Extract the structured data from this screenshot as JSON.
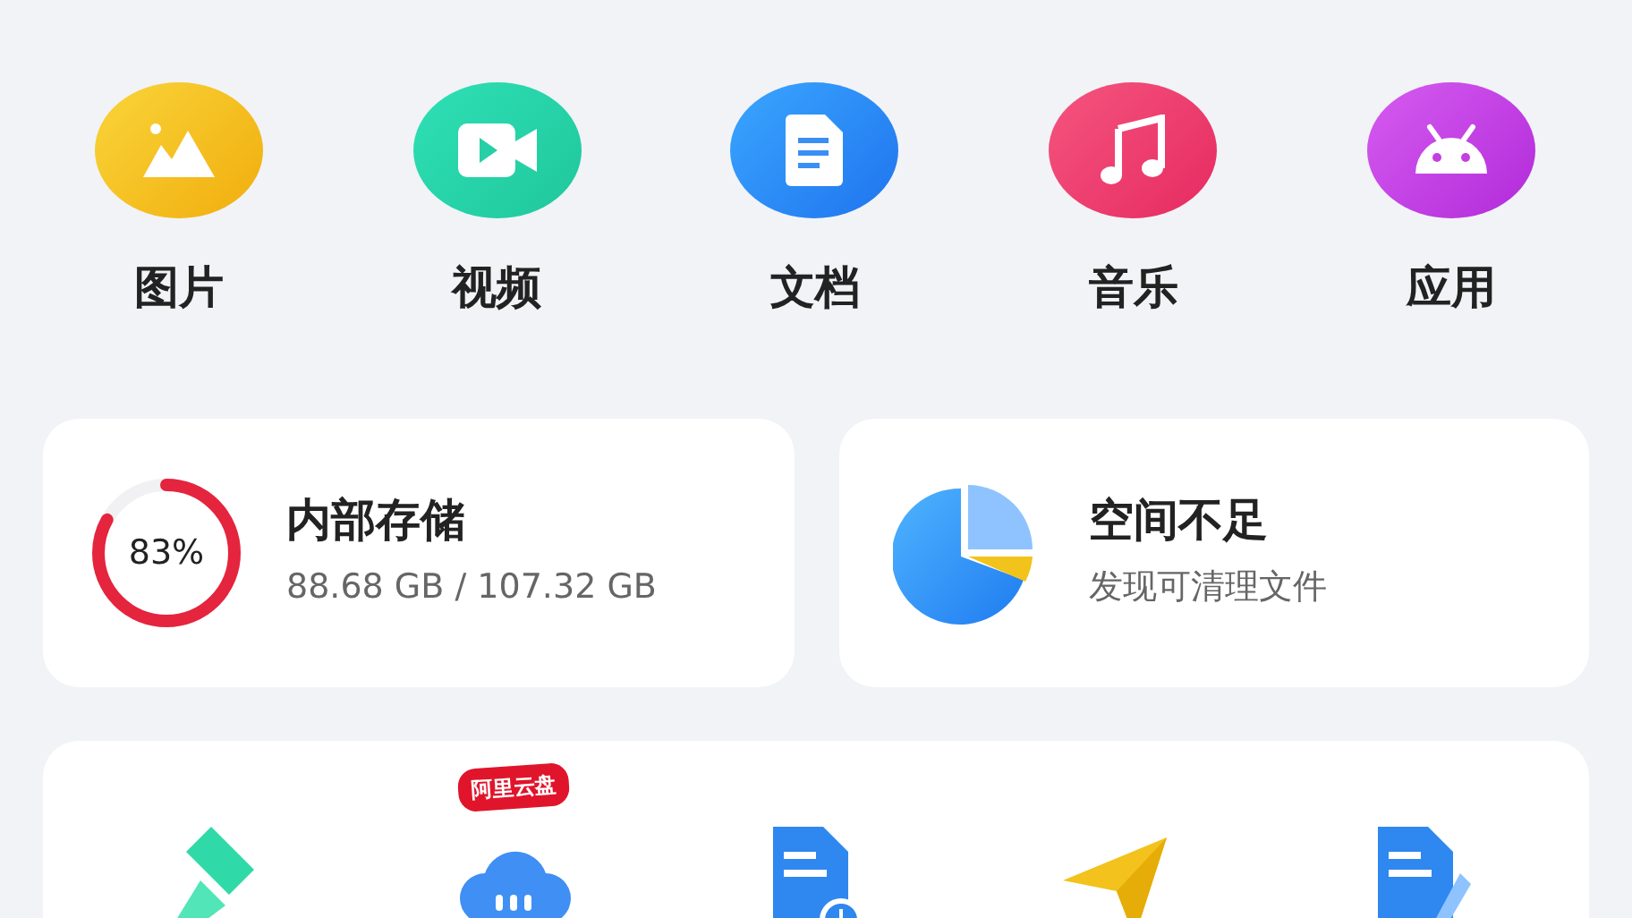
{
  "categories": [
    {
      "label": "图片",
      "kind": "images"
    },
    {
      "label": "视频",
      "kind": "video"
    },
    {
      "label": "文档",
      "kind": "docs"
    },
    {
      "label": "音乐",
      "kind": "music"
    },
    {
      "label": "应用",
      "kind": "apps"
    }
  ],
  "storage": {
    "title": "内部存储",
    "percent": "83%",
    "level": 0.83,
    "usage": "88.68 GB / 107.32 GB"
  },
  "cleanup": {
    "title": "空间不足",
    "subtitle": "发现可清理文件"
  },
  "tools": [
    {
      "kind": "brush"
    },
    {
      "kind": "cloud",
      "badge": "阿里云盘"
    },
    {
      "kind": "recent-doc"
    },
    {
      "kind": "send"
    },
    {
      "kind": "edit-doc"
    }
  ]
}
